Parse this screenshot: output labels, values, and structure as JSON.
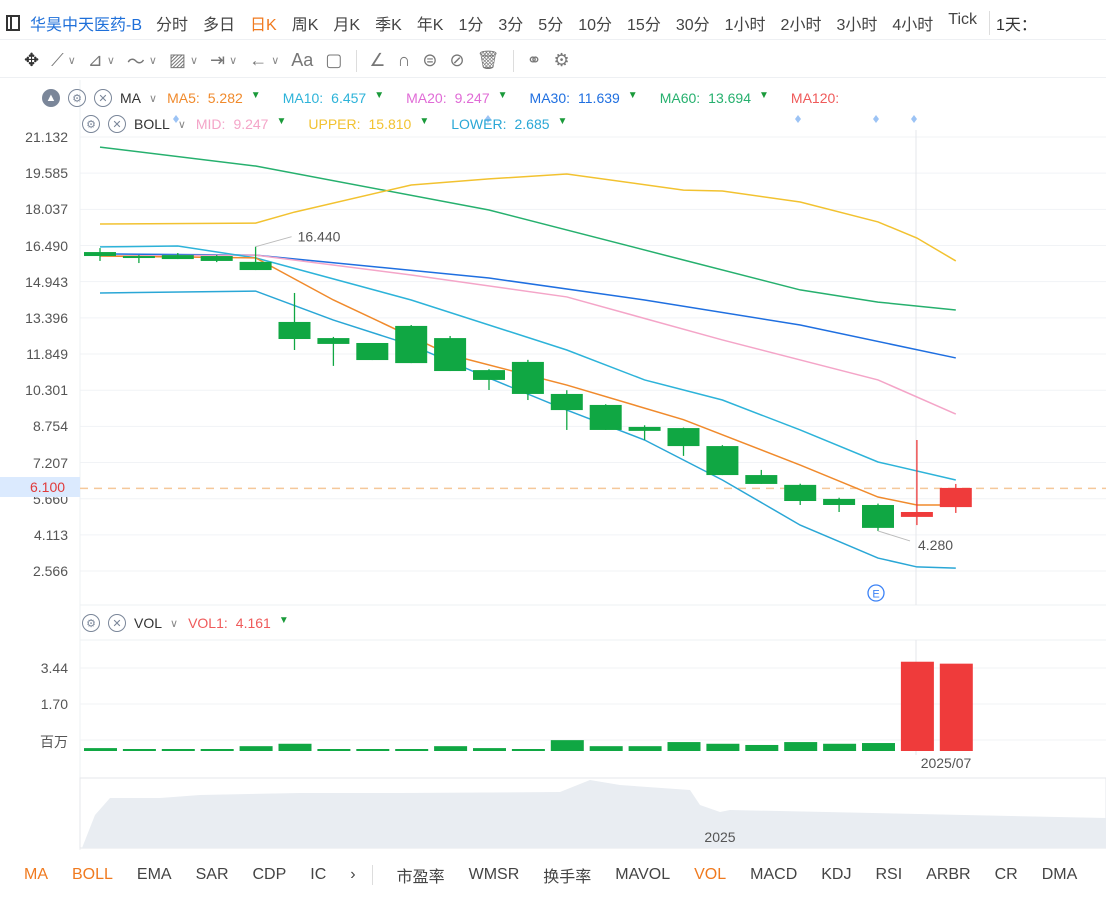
{
  "header": {
    "title": "华昊中天医药-B",
    "periods": [
      "分时",
      "多日",
      "日K",
      "周K",
      "月K",
      "季K",
      "年K",
      "1分",
      "3分",
      "5分",
      "10分",
      "15分",
      "30分",
      "1小时",
      "2小时",
      "3小时",
      "4小时",
      "Tick"
    ],
    "active_period": "日K",
    "interval_label": "1天："
  },
  "toolbar": {
    "icons": [
      "move-icon",
      "line-icon",
      "polyline-icon",
      "wave-icon",
      "fibonacci-icon",
      "measure-icon",
      "arrow-icon",
      "text-icon",
      "comment-icon",
      "angle-icon",
      "magnet-icon",
      "lock-icon",
      "hide-icon",
      "trash-icon",
      "compare-icon",
      "settings-icon"
    ],
    "text_label": "Aa"
  },
  "legend_ma": {
    "name": "MA",
    "items": [
      {
        "k": "MA5:",
        "v": "5.282",
        "color": "#f08a2c"
      },
      {
        "k": "MA10:",
        "v": "6.457",
        "color": "#2db3d9"
      },
      {
        "k": "MA20:",
        "v": "9.247",
        "color": "#e06bd6"
      },
      {
        "k": "MA30:",
        "v": "11.639",
        "color": "#1f6fe0"
      },
      {
        "k": "MA60:",
        "v": "13.694",
        "color": "#26b06e"
      },
      {
        "k": "MA120:",
        "v": "",
        "color": "#ef5a5a"
      }
    ]
  },
  "legend_boll": {
    "name": "BOLL",
    "items": [
      {
        "k": "MID:",
        "v": "9.247",
        "color": "#f4a5c8"
      },
      {
        "k": "UPPER:",
        "v": "15.810",
        "color": "#f2c230"
      },
      {
        "k": "LOWER:",
        "v": "2.685",
        "color": "#2aa7d6"
      }
    ]
  },
  "legend_vol": {
    "name": "VOL",
    "items": [
      {
        "k": "VOL1:",
        "v": "4.161",
        "color": "#ef5a5a"
      }
    ]
  },
  "price_axis": [
    "21.132",
    "19.585",
    "18.037",
    "16.490",
    "14.943",
    "13.396",
    "11.849",
    "10.301",
    "8.754",
    "7.207",
    "5.660",
    "4.113",
    "2.566"
  ],
  "current_price": "6.100",
  "vol_axis": [
    "3.44",
    "1.70"
  ],
  "vol_unit": "百万",
  "annotations": {
    "high": "16.440",
    "low": "4.280",
    "date": "2025/07",
    "nav_year": "2025",
    "event_marker": "E"
  },
  "bottom_tabs": [
    "MA",
    "BOLL",
    "EMA",
    "SAR",
    "CDP",
    "IC",
    "市盈率",
    "WMSR",
    "换手率",
    "MAVOL",
    "VOL",
    "MACD",
    "KDJ",
    "RSI",
    "ARBR",
    "CR",
    "DMA"
  ],
  "bottom_active": [
    "MA",
    "BOLL",
    "VOL"
  ],
  "colors": {
    "up": "#ef3b3b",
    "down": "#10a743"
  },
  "chart_data": {
    "type": "candlestick",
    "ylim": [
      2.566,
      21.132
    ],
    "candles": [
      [
        16.21,
        16.38,
        15.83,
        16.04
      ],
      [
        16.04,
        16.08,
        15.74,
        15.96
      ],
      [
        16.08,
        16.17,
        15.91,
        15.91
      ],
      [
        16.04,
        16.08,
        15.78,
        15.83
      ],
      [
        15.79,
        16.44,
        15.44,
        15.44
      ],
      [
        13.22,
        14.46,
        12.02,
        12.49
      ],
      [
        12.53,
        12.58,
        11.34,
        12.28
      ],
      [
        12.32,
        12.32,
        11.59,
        11.59
      ],
      [
        13.05,
        13.09,
        11.46,
        11.46
      ],
      [
        12.53,
        12.62,
        11.12,
        11.12
      ],
      [
        11.16,
        11.2,
        10.31,
        10.74
      ],
      [
        11.51,
        11.6,
        9.88,
        10.14
      ],
      [
        10.14,
        10.3,
        8.6,
        9.45
      ],
      [
        9.67,
        9.7,
        8.6,
        8.6
      ],
      [
        8.73,
        8.8,
        8.17,
        8.56
      ],
      [
        8.68,
        8.7,
        7.49,
        7.91
      ],
      [
        7.91,
        7.95,
        6.67,
        6.67
      ],
      [
        6.67,
        6.89,
        6.29,
        6.29
      ],
      [
        6.25,
        6.3,
        5.39,
        5.56
      ],
      [
        5.65,
        5.7,
        5.09,
        5.39
      ],
      [
        5.39,
        5.45,
        4.28,
        4.41
      ],
      [
        4.88,
        8.17,
        4.53,
        5.09
      ],
      [
        5.3,
        6.29,
        5.05,
        6.12
      ]
    ],
    "volume": [
      0.12,
      0.05,
      0.05,
      0.08,
      0.2,
      0.3,
      0.05,
      0.05,
      0.05,
      0.2,
      0.12,
      0.05,
      0.45,
      0.2,
      0.2,
      0.37,
      0.3,
      0.25,
      0.37,
      0.3,
      0.33,
      3.7,
      3.62
    ],
    "vol_ylim": [
      0,
      3.44
    ],
    "lines": [
      {
        "name": "MA60",
        "color": "#26b06e",
        "pts": [
          [
            0,
            20.7
          ],
          [
            4,
            19.89
          ],
          [
            10,
            18.01
          ],
          [
            15,
            15.87
          ],
          [
            18,
            14.59
          ],
          [
            20,
            14.07
          ],
          [
            22,
            13.73
          ]
        ]
      },
      {
        "name": "UPPER",
        "color": "#f2c230",
        "pts": [
          [
            0,
            17.41
          ],
          [
            4,
            17.45
          ],
          [
            5,
            17.92
          ],
          [
            8,
            19.08
          ],
          [
            10,
            19.34
          ],
          [
            12,
            19.55
          ],
          [
            15,
            18.86
          ],
          [
            16,
            18.82
          ],
          [
            18,
            18.35
          ],
          [
            20,
            17.5
          ],
          [
            21,
            16.81
          ],
          [
            22,
            15.83
          ]
        ]
      },
      {
        "name": "MA30",
        "color": "#1f6fe0",
        "pts": [
          [
            0,
            16.13
          ],
          [
            4,
            16.08
          ],
          [
            10,
            15.1
          ],
          [
            14,
            14.16
          ],
          [
            18,
            13.09
          ],
          [
            22,
            11.68
          ]
        ]
      },
      {
        "name": "MA20",
        "color": "#f4a5c8",
        "pts": [
          [
            0,
            16.04
          ],
          [
            4,
            16.08
          ],
          [
            8,
            15.23
          ],
          [
            12,
            14.29
          ],
          [
            16,
            12.45
          ],
          [
            20,
            10.74
          ],
          [
            22,
            9.28
          ]
        ]
      },
      {
        "name": "MA10",
        "color": "#2db3d9",
        "pts": [
          [
            0,
            16.43
          ],
          [
            2,
            16.47
          ],
          [
            4,
            15.96
          ],
          [
            8,
            14.16
          ],
          [
            12,
            12.02
          ],
          [
            14,
            10.74
          ],
          [
            16,
            9.88
          ],
          [
            18,
            8.6
          ],
          [
            20,
            7.23
          ],
          [
            22,
            6.46
          ]
        ]
      },
      {
        "name": "LOWER",
        "color": "#2aa7d6",
        "pts": [
          [
            0,
            14.46
          ],
          [
            4,
            14.54
          ],
          [
            6,
            13.3
          ],
          [
            8,
            12.23
          ],
          [
            10,
            10.82
          ],
          [
            12,
            9.45
          ],
          [
            14,
            8.17
          ],
          [
            16,
            6.46
          ],
          [
            18,
            4.53
          ],
          [
            20,
            3.12
          ],
          [
            21,
            2.74
          ],
          [
            22,
            2.69
          ]
        ]
      },
      {
        "name": "MA5",
        "color": "#f08a2c",
        "pts": [
          [
            0,
            16.04
          ],
          [
            4,
            15.96
          ],
          [
            6,
            14.16
          ],
          [
            9,
            11.81
          ],
          [
            12,
            10.52
          ],
          [
            15,
            9.04
          ],
          [
            18,
            7.1
          ],
          [
            20,
            5.73
          ],
          [
            21,
            5.39
          ],
          [
            22,
            5.39
          ]
        ]
      }
    ]
  }
}
